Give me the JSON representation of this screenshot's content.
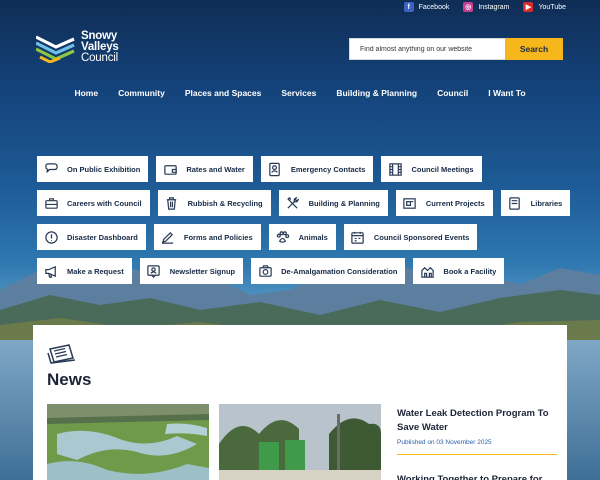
{
  "social": {
    "facebook": "Facebook",
    "instagram": "Instagram",
    "youtube": "YouTube"
  },
  "logo": {
    "line1": "Snowy",
    "line2": "Valleys",
    "line3": "Council"
  },
  "search": {
    "placeholder": "Find almost anything on our website",
    "button": "Search"
  },
  "nav": [
    "Home",
    "Community",
    "Places and Spaces",
    "Services",
    "Building & Planning",
    "Council",
    "I Want To"
  ],
  "quick_links": [
    [
      "On Public Exhibition",
      "Rates and Water",
      "Emergency Contacts",
      "Council Meetings"
    ],
    [
      "Careers with Council",
      "Rubbish & Recycling",
      "Building & Planning",
      "Current Projects",
      "Libraries"
    ],
    [
      "Disaster Dashboard",
      "Forms and Policies",
      "Animals",
      "Council Sponsored Events"
    ],
    [
      "Make a Request",
      "Newsletter Signup",
      "De-Amalgamation Consideration",
      "Book a Facility"
    ]
  ],
  "news": {
    "title": "News",
    "article1": {
      "title": "Water Leak Detection Program To Save Water",
      "date": "Published on 03 November 2025"
    },
    "article2": {
      "title": "Working Together to Prepare for"
    }
  },
  "colors": {
    "accent": "#f5b71c",
    "date_blue": "#2b5fa6",
    "text_dark": "#172a45"
  }
}
